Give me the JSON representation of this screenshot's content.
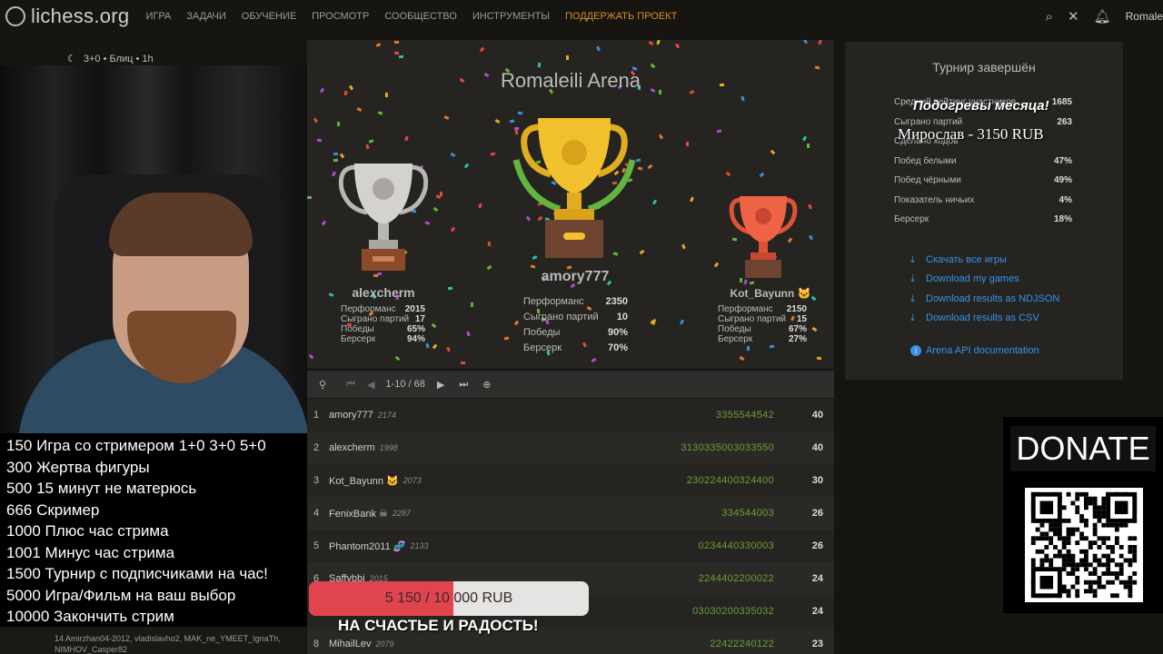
{
  "nav": {
    "site": "lichess.org",
    "links": [
      "ИГРА",
      "ЗАДАЧИ",
      "ОБУЧЕНИЕ",
      "ПРОСМОТР",
      "СООБЩЕСТВО",
      "ИНСТРУМЕНТЫ"
    ],
    "support": "ПОДДЕРЖАТЬ ПРОЕКТ",
    "user": "Romale"
  },
  "tournament": {
    "tag": "3+0 • Блиц • 1h",
    "title": "Romaleili Arena"
  },
  "podium": {
    "first": {
      "name": "amory777",
      "stats": [
        [
          "Перформанс",
          "2350"
        ],
        [
          "Сыграно партий",
          "10"
        ],
        [
          "Победы",
          "90%"
        ],
        [
          "Берсерк",
          "70%"
        ]
      ]
    },
    "second": {
      "name": "alexcherm",
      "stats": [
        [
          "Перформанс",
          "2015"
        ],
        [
          "Сыграно партий",
          "17"
        ],
        [
          "Победы",
          "65%"
        ],
        [
          "Берсерк",
          "94%"
        ]
      ]
    },
    "third": {
      "name": "Kot_Bayunn 🐱",
      "stats": [
        [
          "Перформанс",
          "2150"
        ],
        [
          "Сыграно партий",
          "15"
        ],
        [
          "Победы",
          "67%"
        ],
        [
          "Берсерк",
          "27%"
        ]
      ]
    }
  },
  "pager": {
    "range": "1-10 / 68"
  },
  "standings": [
    {
      "rank": "1",
      "player": "amory777",
      "rating": "2174",
      "sheet": "3355544542",
      "score": "40"
    },
    {
      "rank": "2",
      "player": "alexcherm",
      "rating": "1998",
      "sheet": "3130335003033550",
      "score": "40"
    },
    {
      "rank": "3",
      "player": "Kot_Bayunn 🐱",
      "rating": "2073",
      "sheet": "230224400324400",
      "score": "30"
    },
    {
      "rank": "4",
      "player": "FenixBank ☠",
      "rating": "2287",
      "sheet": "334544003",
      "score": "26"
    },
    {
      "rank": "5",
      "player": "Phantom2011 🧬",
      "rating": "2133",
      "sheet": "0234440330003",
      "score": "26"
    },
    {
      "rank": "6",
      "player": "Saffybbi",
      "rating": "2015",
      "sheet": "2244402200022",
      "score": "24"
    },
    {
      "rank": "7",
      "player": "",
      "rating": "",
      "sheet": "03030200335032",
      "score": "24"
    },
    {
      "rank": "8",
      "player": "MihailLev",
      "rating": "2079",
      "sheet": "22422240122",
      "score": "23"
    }
  ],
  "side": {
    "title": "Турнир завершён",
    "stats": [
      [
        "Средний рейтинг участников",
        "1685"
      ],
      [
        "Сыграно партий",
        "263"
      ],
      [
        "Сделано ходов",
        ""
      ],
      [
        "Побед белыми",
        "47%"
      ],
      [
        "Побед чёрными",
        "49%"
      ],
      [
        "Показатель ничьих",
        "4%"
      ],
      [
        "Берсерк",
        "18%"
      ]
    ],
    "links": [
      "Скачать все игры",
      "Download my games",
      "Download results as NDJSON",
      "Download results as CSV"
    ],
    "api": "Arena API documentation"
  },
  "overlay": {
    "heat_title": "Подогревы месяца!",
    "heat_name": "Мирослав - 3150 RUB",
    "rewards": [
      "150 Игра со стримером 1+0 3+0 5+0",
      "300 Жертва фигуры",
      "500 15 минут не матерюсь",
      "666 Скример",
      "1000 Плюс час стрима",
      "1001 Минус час стрима",
      "1500 Турнир с подписчиками на час!",
      "5000 Игра/Фильм на ваш выбор",
      "10000 Закончить стрим"
    ],
    "chat": "14  Amirzhan04-2012, vladislavho2, MAK_ne_YMEET_IgnaTh, NIMHOV_Casper82",
    "donate_label": "DONATE",
    "goal_text": "5 150 / 10 000 RUB",
    "goal_progress": 0.515,
    "goal_caption": "НА СЧАСТЬЕ И РАДОСТЬ!"
  }
}
